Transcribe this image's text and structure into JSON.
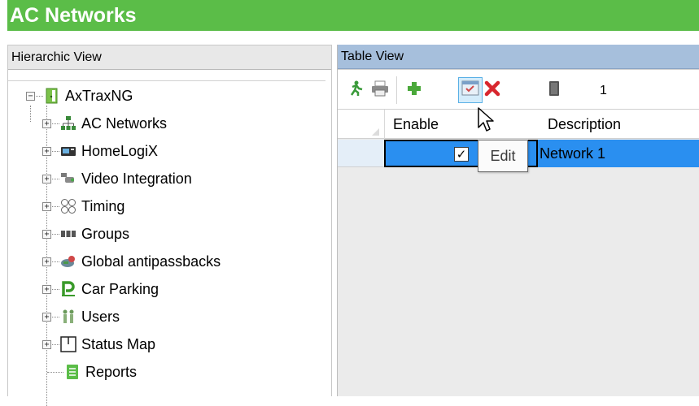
{
  "window": {
    "title": "AC Networks"
  },
  "left_pane": {
    "header": "Hierarchic View",
    "tree": {
      "root": {
        "label": "AxTraxNG",
        "icon": "door-exit-icon"
      },
      "items": [
        {
          "label": "AC Networks",
          "icon": "network-icon"
        },
        {
          "label": "HomeLogiX",
          "icon": "home-device-icon"
        },
        {
          "label": "Video Integration",
          "icon": "video-camera-icon"
        },
        {
          "label": "Timing",
          "icon": "timing-icon"
        },
        {
          "label": "Groups",
          "icon": "groups-icon"
        },
        {
          "label": "Global antipassbacks",
          "icon": "antipassback-icon"
        },
        {
          "label": "Car Parking",
          "icon": "car-parking-icon"
        },
        {
          "label": "Users",
          "icon": "users-icon"
        },
        {
          "label": "Status Map",
          "icon": "status-map-icon"
        },
        {
          "label": "Reports",
          "icon": "reports-icon"
        }
      ]
    }
  },
  "right_pane": {
    "header": "Table View",
    "toolbar": {
      "buttons": [
        {
          "name": "exit",
          "icon": "exit-icon"
        },
        {
          "name": "print",
          "icon": "printer-icon"
        },
        {
          "name": "add",
          "icon": "plus-icon"
        },
        {
          "name": "edit",
          "icon": "edit-icon"
        },
        {
          "name": "delete",
          "icon": "delete-icon"
        },
        {
          "name": "device",
          "icon": "device-icon"
        }
      ],
      "record_count": "1"
    },
    "grid": {
      "columns": [
        "Enable",
        "Description"
      ],
      "rows": [
        {
          "enable": true,
          "enable_mark": "✓",
          "description": "Network 1"
        }
      ]
    },
    "tooltip": "Edit"
  },
  "colors": {
    "title_bar": "#5bbd48",
    "table_header": "#a6bfdc",
    "selection": "#2a8ff0"
  }
}
